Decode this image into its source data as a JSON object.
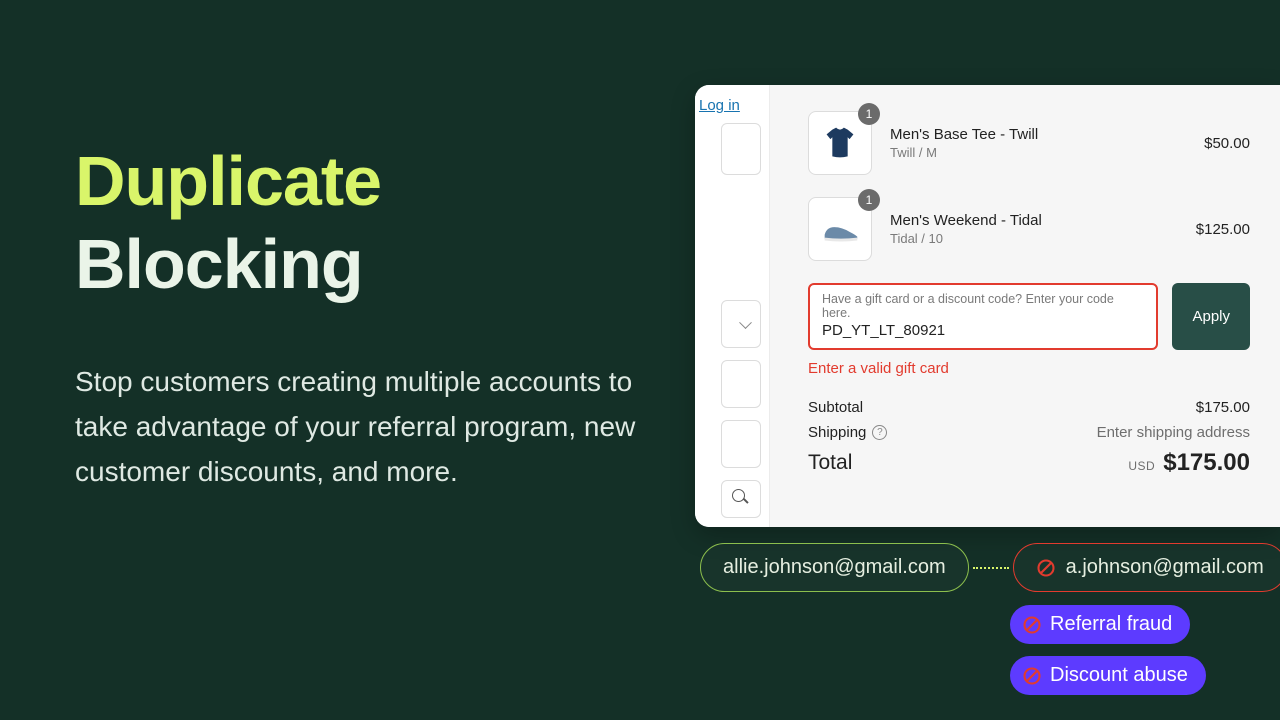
{
  "hero": {
    "title_line1": "Duplicate",
    "title_line2": "Blocking",
    "body": "Stop customers creating multiple accounts to take advantage of your referral program, new customer discounts, and more."
  },
  "checkout": {
    "login_label": "Log in",
    "items": [
      {
        "name": "Men's Base Tee - Twill",
        "variant": "Twill / M",
        "qty": "1",
        "price": "$50.00"
      },
      {
        "name": "Men's Weekend - Tidal",
        "variant": "Tidal / 10",
        "qty": "1",
        "price": "$125.00"
      }
    ],
    "promo": {
      "placeholder": "Have a gift card or a discount code? Enter your code here.",
      "value": "PD_YT_LT_80921",
      "apply_label": "Apply",
      "error": "Enter a valid gift card"
    },
    "subtotal_label": "Subtotal",
    "subtotal_value": "$175.00",
    "shipping_label": "Shipping",
    "shipping_value": "Enter shipping address",
    "total_label": "Total",
    "total_currency": "USD",
    "total_value": "$175.00"
  },
  "emails": {
    "good": "allie.johnson@gmail.com",
    "bad": "a.johnson@gmail.com"
  },
  "tags": {
    "referral": "Referral fraud",
    "discount": "Discount abuse"
  },
  "colors": {
    "bg": "#143027",
    "accent": "#d9f56a",
    "error": "#e23b2e",
    "tag": "#5d3bff",
    "apply": "#284e47"
  }
}
